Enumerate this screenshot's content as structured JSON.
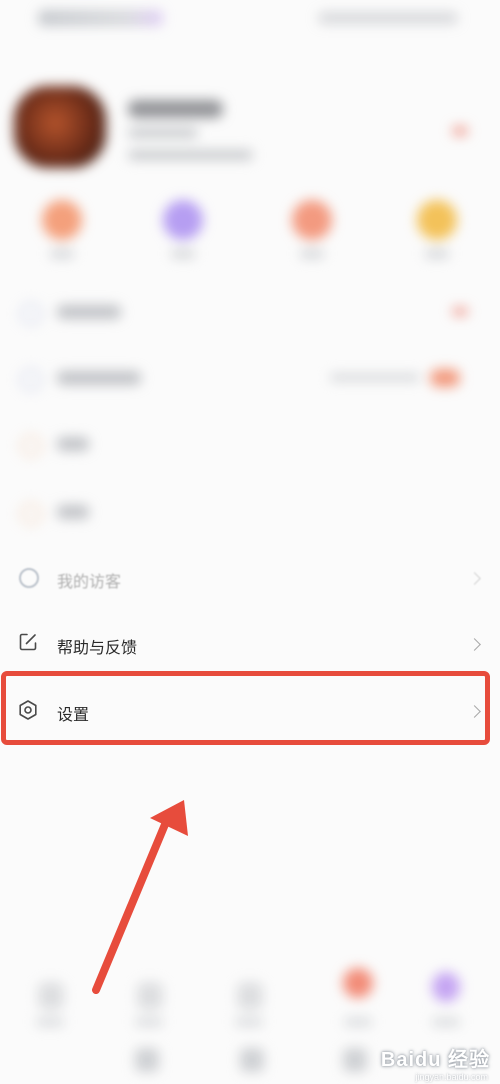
{
  "menu": {
    "visitors_label": "我的访客",
    "help_label": "帮助与反馈",
    "settings_label": "设置"
  },
  "watermark": {
    "text": "Baidu 经验",
    "sub": "jingyan.baidu.com"
  },
  "colors": {
    "highlight": "#e74c3c",
    "arrow": "#e74c3c",
    "icon_stroke": "#4a4a4a"
  },
  "icons": {
    "help": "edit-square-icon",
    "settings": "gear-icon",
    "chevron": "chevron-right-icon"
  }
}
